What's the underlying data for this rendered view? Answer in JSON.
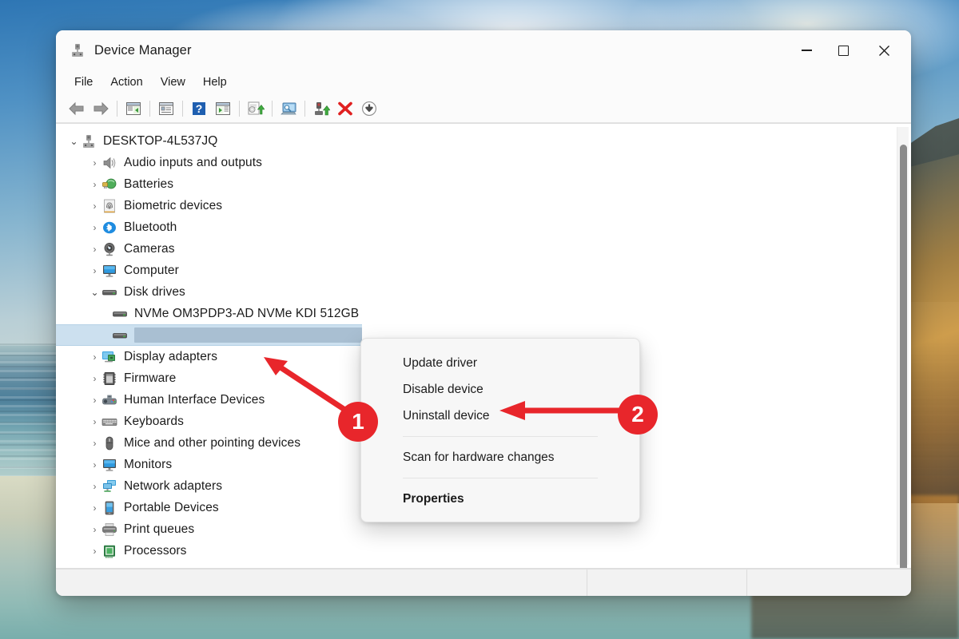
{
  "window": {
    "title": "Device Manager",
    "title_icon": "device-manager-icon",
    "controls": {
      "minimize": "Minimize",
      "maximize": "Maximize",
      "close": "Close"
    }
  },
  "menubar": {
    "items": [
      {
        "label": "File",
        "name": "menu-file"
      },
      {
        "label": "Action",
        "name": "menu-action"
      },
      {
        "label": "View",
        "name": "menu-view"
      },
      {
        "label": "Help",
        "name": "menu-help"
      }
    ]
  },
  "toolbar": {
    "buttons": [
      {
        "name": "back-icon",
        "title": "Back"
      },
      {
        "name": "forward-icon",
        "title": "Forward"
      },
      {
        "name": "show-hide-console-tree-icon",
        "title": "Show/Hide Console Tree"
      },
      {
        "name": "properties-icon",
        "title": "Properties"
      },
      {
        "name": "help-icon",
        "title": "Help"
      },
      {
        "name": "show-hide-action-pane-icon",
        "title": "Show/Hide Action Pane"
      },
      {
        "name": "update-driver-icon",
        "title": "Update Driver Software"
      },
      {
        "name": "scan-for-hardware-changes-icon",
        "title": "Scan for hardware changes"
      },
      {
        "name": "enable-device-icon",
        "title": "Enable device"
      },
      {
        "name": "uninstall-device-icon",
        "title": "Uninstall device"
      },
      {
        "name": "disable-device-icon",
        "title": "Disable device"
      }
    ]
  },
  "tree": {
    "root": {
      "label": "DESKTOP-4L537JQ",
      "icon": "computer-node-icon",
      "expanded": true
    },
    "items": [
      {
        "label": "Audio inputs and outputs",
        "icon": "speaker-icon",
        "level": 1,
        "expanded": false
      },
      {
        "label": "Batteries",
        "icon": "battery-icon",
        "level": 1,
        "expanded": false
      },
      {
        "label": "Biometric devices",
        "icon": "fingerprint-icon",
        "level": 1,
        "expanded": false
      },
      {
        "label": "Bluetooth",
        "icon": "bluetooth-icon",
        "level": 1,
        "expanded": false
      },
      {
        "label": "Cameras",
        "icon": "camera-icon",
        "level": 1,
        "expanded": false
      },
      {
        "label": "Computer",
        "icon": "monitor-icon",
        "level": 1,
        "expanded": false
      },
      {
        "label": "Disk drives",
        "icon": "disk-drive-icon",
        "level": 1,
        "expanded": true
      },
      {
        "label": "NVMe OM3PDP3-AD NVMe KDI 512GB",
        "icon": "disk-drive-icon",
        "level": 2,
        "leaf": true
      },
      {
        "label": "",
        "icon": "disk-drive-icon",
        "level": 2,
        "leaf": true,
        "selected": true,
        "redacted": true
      },
      {
        "label": "Display adapters",
        "icon": "display-adapter-icon",
        "level": 1,
        "expanded": false
      },
      {
        "label": "Firmware",
        "icon": "firmware-chip-icon",
        "level": 1,
        "expanded": false
      },
      {
        "label": "Human Interface Devices",
        "icon": "hid-icon",
        "level": 1,
        "expanded": false
      },
      {
        "label": "Keyboards",
        "icon": "keyboard-icon",
        "level": 1,
        "expanded": false
      },
      {
        "label": "Mice and other pointing devices",
        "icon": "mouse-icon",
        "level": 1,
        "expanded": false
      },
      {
        "label": "Monitors",
        "icon": "monitor-icon",
        "level": 1,
        "expanded": false
      },
      {
        "label": "Network adapters",
        "icon": "network-adapter-icon",
        "level": 1,
        "expanded": false
      },
      {
        "label": "Portable Devices",
        "icon": "portable-device-icon",
        "level": 1,
        "expanded": false
      },
      {
        "label": "Print queues",
        "icon": "printer-icon",
        "level": 1,
        "expanded": false
      },
      {
        "label": "Processors",
        "icon": "processor-icon",
        "level": 1,
        "expanded": false
      }
    ],
    "chevron_collapsed": "›",
    "chevron_expanded": "⌄"
  },
  "context_menu": {
    "items": [
      {
        "label": "Update driver",
        "name": "ctx-update-driver",
        "bold": false
      },
      {
        "label": "Disable device",
        "name": "ctx-disable-device",
        "bold": false
      },
      {
        "label": "Uninstall device",
        "name": "ctx-uninstall-device",
        "bold": false
      },
      {
        "label": "Scan for hardware changes",
        "name": "ctx-scan-hardware-changes",
        "bold": false
      },
      {
        "label": "Properties",
        "name": "ctx-properties",
        "bold": true
      }
    ]
  },
  "annotations": [
    {
      "number": "1",
      "name": "annotation-badge-1",
      "target": "selected device row"
    },
    {
      "number": "2",
      "name": "annotation-badge-2",
      "target": "Uninstall device menu item"
    }
  ],
  "colors": {
    "annotation_red": "#e8262b",
    "selection_blue": "#cce0ef",
    "redaction_gray": "#a9bfd2",
    "window_bg": "#ffffff",
    "chrome_bg": "#fbfbfb",
    "menu_bg": "#f7f7f7",
    "scrollbar_thumb": "#8a8a8a"
  },
  "scrollbar": {
    "name": "vertical-scrollbar",
    "orientation": "vertical"
  },
  "statusbar": {
    "cells": [
      "",
      "",
      ""
    ]
  }
}
